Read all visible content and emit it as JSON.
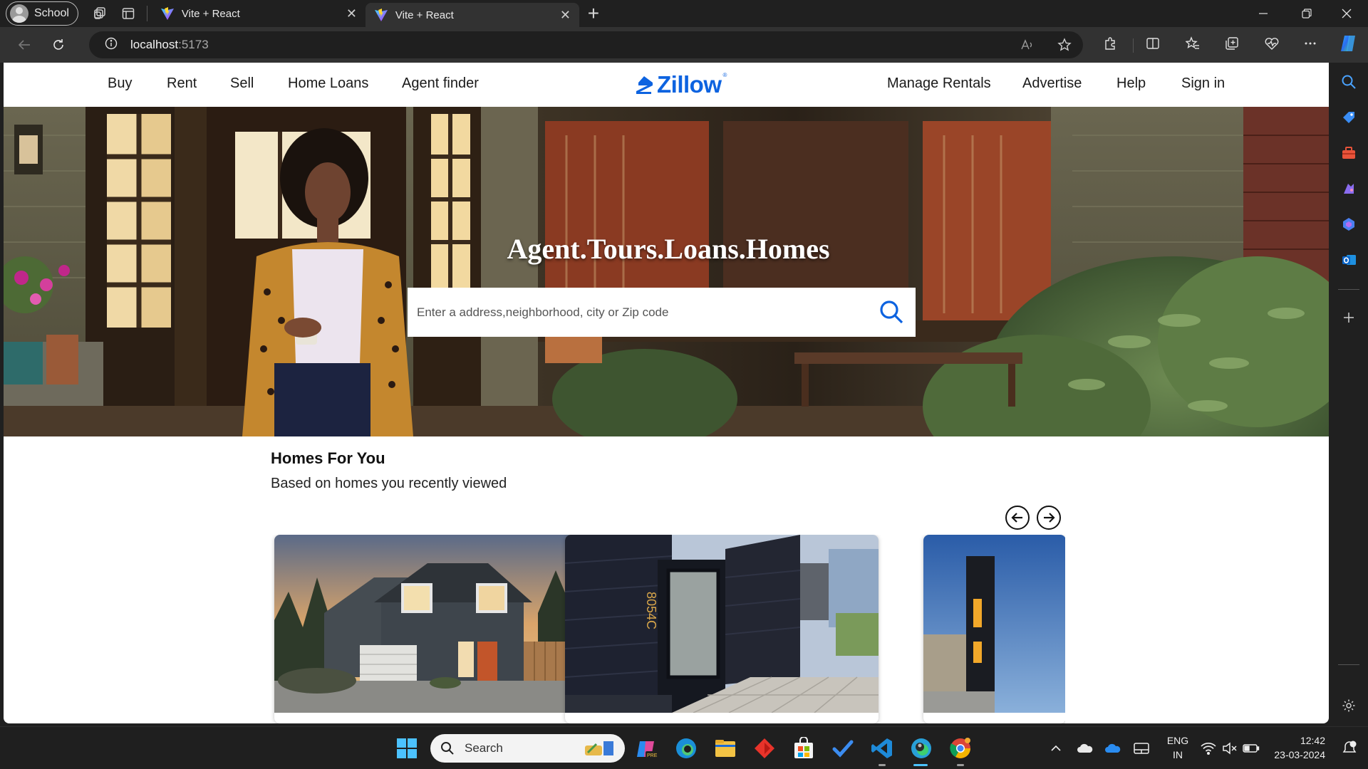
{
  "browser": {
    "profile_label": "School",
    "tabs": [
      {
        "title": "Vite + React"
      },
      {
        "title": "Vite + React"
      }
    ],
    "url_host": "localhost",
    "url_port": ":5173"
  },
  "site": {
    "nav_left": [
      "Buy",
      "Rent",
      "Sell",
      "Home Loans",
      "Agent finder"
    ],
    "logo_text": "Zillow",
    "logo_mark": "®",
    "nav_right": [
      "Manage Rentals",
      "Advertise",
      "Help",
      "Sign in"
    ],
    "hero_headline": "Agent.Tours.Loans.Homes",
    "search_placeholder": "Enter a address,neighborhood, city or Zip code",
    "section_title": "Homes For You",
    "section_subtitle": "Based on homes you recently viewed",
    "card_house_number": "8054C",
    "brand_color": "#0d63e0"
  },
  "taskbar": {
    "search_label": "Search",
    "lang_line1": "ENG",
    "lang_line2": "IN",
    "time": "12:42",
    "date": "23-03-2024"
  }
}
